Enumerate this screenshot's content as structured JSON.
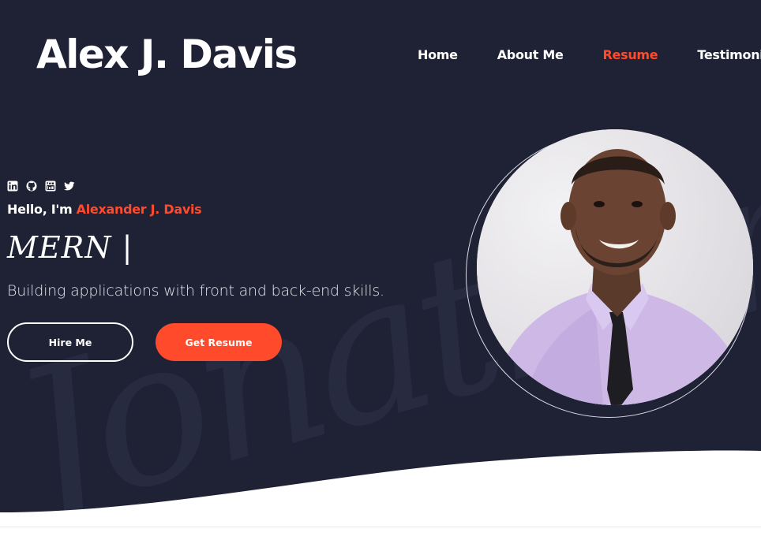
{
  "header": {
    "brand": "Alex J. Davis",
    "nav": [
      {
        "label": "Home",
        "active": false
      },
      {
        "label": "About Me",
        "active": false
      },
      {
        "label": "Resume",
        "active": true
      },
      {
        "label": "Testimonial",
        "active": false
      }
    ]
  },
  "hero": {
    "socials": [
      "linkedin-icon",
      "github-icon",
      "youtube-icon",
      "twitter-icon"
    ],
    "greeting": "Hello, I'm ",
    "name": "Alexander J. Davis",
    "role": "MERN |",
    "tagline": "Building applications with front and back-end skills.",
    "hire_label": "Hire Me",
    "resume_label": "Get Resume",
    "watermark": "Jonathan"
  },
  "colors": {
    "background": "#1f2235",
    "accent": "#ff4a2b",
    "text": "#ffffff"
  }
}
